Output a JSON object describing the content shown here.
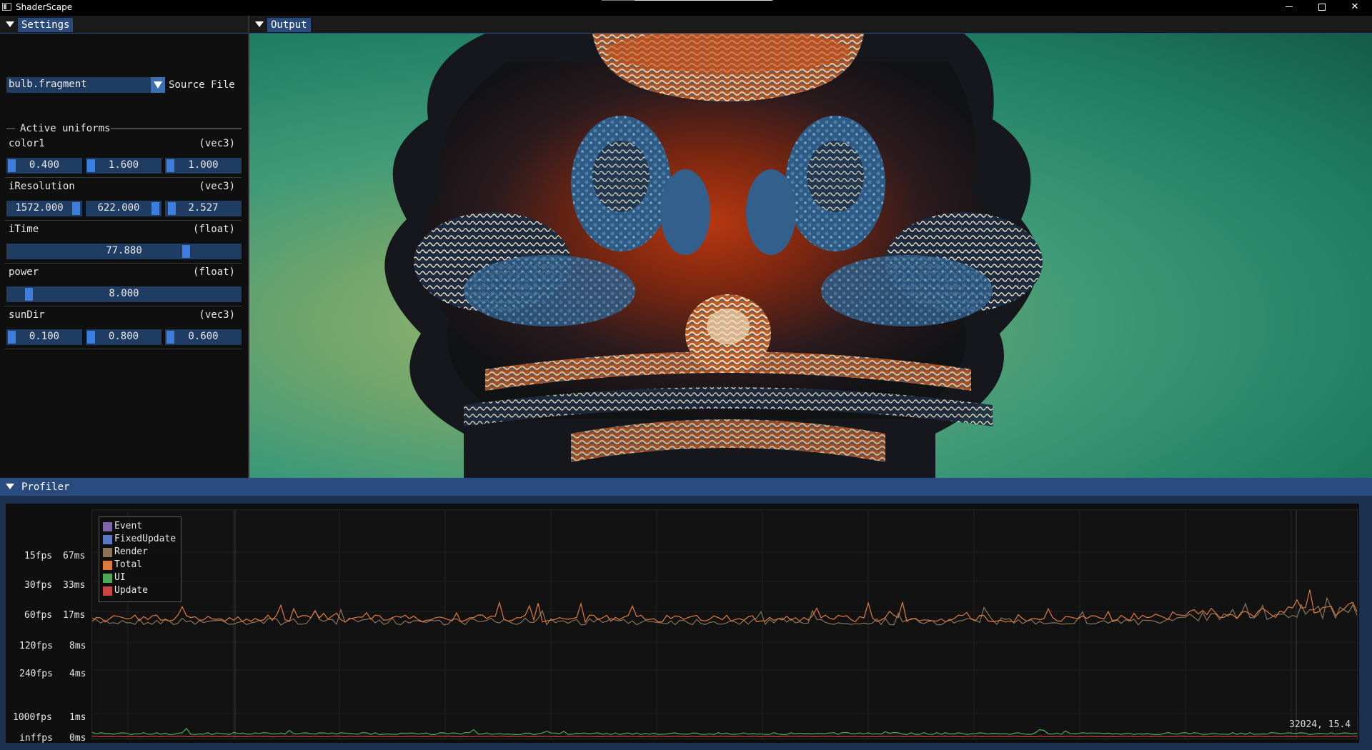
{
  "window": {
    "title": "ShaderScape"
  },
  "settings": {
    "tab_label": "Settings",
    "source_combo_value": "bulb.fragment",
    "source_label": "Source File",
    "uniforms_header": "Active uniforms",
    "uniforms": [
      {
        "name": "color1",
        "type": "(vec3)",
        "values": [
          "0.400",
          "1.600",
          "1.000"
        ]
      },
      {
        "name": "iResolution",
        "type": "(vec3)",
        "values": [
          "1572.000",
          "622.000",
          "2.527"
        ]
      },
      {
        "name": "iTime",
        "type": "(float)",
        "values": [
          "77.880"
        ]
      },
      {
        "name": "power",
        "type": "(float)",
        "values": [
          "8.000"
        ]
      },
      {
        "name": "sunDir",
        "type": "(vec3)",
        "values": [
          "0.100",
          "0.800",
          "0.600"
        ]
      }
    ]
  },
  "output": {
    "tab_label": "Output"
  },
  "profiler": {
    "tab_label": "Profiler",
    "y_labels": [
      {
        "fps": "15fps",
        "ms": "67ms"
      },
      {
        "fps": "30fps",
        "ms": "33ms"
      },
      {
        "fps": "60fps",
        "ms": "17ms"
      },
      {
        "fps": "120fps",
        "ms": "8ms"
      },
      {
        "fps": "240fps",
        "ms": "4ms"
      },
      {
        "fps": "1000fps",
        "ms": "1ms"
      },
      {
        "fps": "inffps",
        "ms": "0ms"
      }
    ],
    "legend": [
      {
        "name": "Event",
        "color": "#7e67a8"
      },
      {
        "name": "FixedUpdate",
        "color": "#5b78c6"
      },
      {
        "name": "Render",
        "color": "#8a7358"
      },
      {
        "name": "Total",
        "color": "#e07a3c"
      },
      {
        "name": "UI",
        "color": "#4ea85a"
      },
      {
        "name": "Update",
        "color": "#c84545"
      }
    ],
    "cursor_readout": "32024, 15.4"
  }
}
